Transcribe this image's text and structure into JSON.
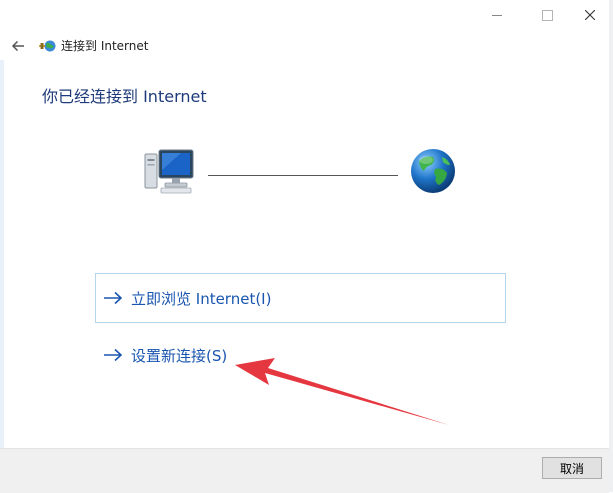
{
  "window": {
    "title": "连接到 Internet",
    "controls": [
      "minimize-icon",
      "maximize-icon",
      "close-icon"
    ]
  },
  "header": {
    "heading": "你已经连接到 Internet"
  },
  "illustration": {
    "left_icon": "computer-icon",
    "right_icon": "globe-icon"
  },
  "commands": [
    {
      "label": "立即浏览 Internet(I)",
      "icon": "arrow-right-icon"
    },
    {
      "label": "设置新连接(S)",
      "icon": "arrow-right-icon"
    }
  ],
  "footer": {
    "cancel_label": "取消"
  },
  "colors": {
    "link": "#1a56b0",
    "heading": "#1d3a7a",
    "annotation": "#e5373f",
    "footer_bg": "#f0f0f0"
  }
}
